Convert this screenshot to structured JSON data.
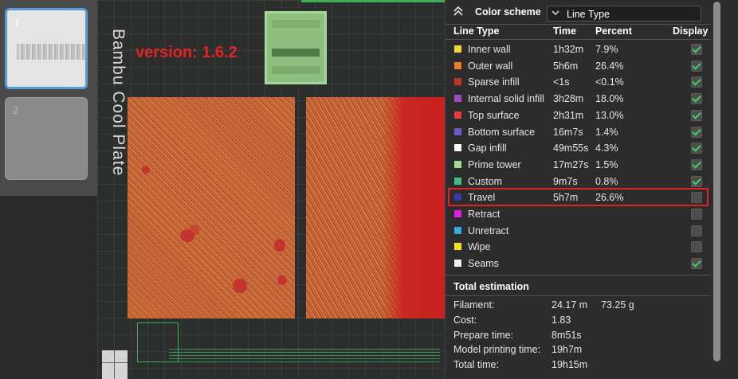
{
  "thumbnails": [
    {
      "number": "1"
    },
    {
      "number": "2"
    }
  ],
  "viewport": {
    "plate_name": "Bambu Cool Plate",
    "version_label": "version: 1.6.2"
  },
  "panel": {
    "collapse_icon": "chevron-double-up-icon",
    "color_scheme_label": "Color scheme",
    "color_scheme_value": "Line Type",
    "columns": {
      "line_type": "Line Type",
      "time": "Time",
      "percent": "Percent",
      "display": "Display"
    },
    "rows": [
      {
        "label": "Inner wall",
        "time": "1h32m",
        "percent": "7.9%",
        "color": "#f2d53a",
        "display": true
      },
      {
        "label": "Outer wall",
        "time": "5h6m",
        "percent": "26.4%",
        "color": "#f07a2a",
        "display": true
      },
      {
        "label": "Sparse infill",
        "time": "<1s",
        "percent": "<0.1%",
        "color": "#b83a26",
        "display": true
      },
      {
        "label": "Internal solid infill",
        "time": "3h28m",
        "percent": "18.0%",
        "color": "#a04ac0",
        "display": true
      },
      {
        "label": "Top surface",
        "time": "2h31m",
        "percent": "13.0%",
        "color": "#e83a3a",
        "display": true
      },
      {
        "label": "Bottom surface",
        "time": "16m7s",
        "percent": "1.4%",
        "color": "#6a5ac8",
        "display": true
      },
      {
        "label": "Gap infill",
        "time": "49m55s",
        "percent": "4.3%",
        "color": "#ffffff",
        "display": true
      },
      {
        "label": "Prime tower",
        "time": "17m27s",
        "percent": "1.5%",
        "color": "#a8d79a",
        "display": true
      },
      {
        "label": "Custom",
        "time": "9m7s",
        "percent": "0.8%",
        "color": "#3fc080",
        "display": true
      },
      {
        "label": "Travel",
        "time": "5h7m",
        "percent": "26.6%",
        "color": "#3a3aa8",
        "display": false
      },
      {
        "label": "Retract",
        "time": "",
        "percent": "",
        "color": "#e020e0",
        "display": false
      },
      {
        "label": "Unretract",
        "time": "",
        "percent": "",
        "color": "#3aa8d8",
        "display": false
      },
      {
        "label": "Wipe",
        "time": "",
        "percent": "",
        "color": "#f2e21a",
        "display": false
      },
      {
        "label": "Seams",
        "time": "",
        "percent": "",
        "color": "#f0f0f0",
        "display": true
      }
    ],
    "total_title": "Total estimation",
    "estimation": [
      {
        "label": "Filament:",
        "value": "24.17 m",
        "value2": "73.25 g"
      },
      {
        "label": "Cost:",
        "value": "1.83",
        "value2": ""
      },
      {
        "label": "Prepare time:",
        "value": "8m51s",
        "value2": ""
      },
      {
        "label": "Model printing time:",
        "value": "19h7m",
        "value2": ""
      },
      {
        "label": "Total time:",
        "value": "19h15m",
        "value2": ""
      }
    ]
  }
}
